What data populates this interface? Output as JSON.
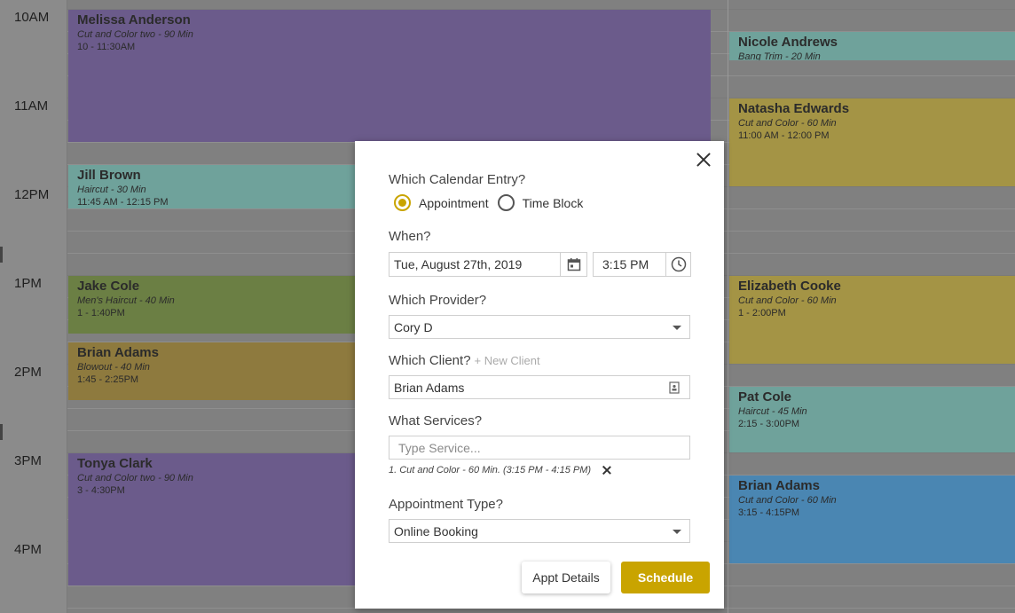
{
  "calendar": {
    "time_labels": [
      "10AM",
      "11AM",
      "12PM",
      "1PM",
      "2PM",
      "3PM",
      "4PM"
    ],
    "left_column": [
      {
        "name": "Melissa Anderson",
        "service": "Cut and Color two - 90 Min",
        "time": "10 - 11:30AM",
        "color": "#6b5b8b"
      },
      {
        "name": "Jill Brown",
        "service": "Haircut - 30 Min",
        "time": "11:45 AM - 12:15 PM",
        "color": "#6fa29b"
      },
      {
        "name": "Jake Cole",
        "service": "Men's Haircut - 40 Min",
        "time": "1 - 1:40PM",
        "color": "#6b7f44"
      },
      {
        "name": "Brian Adams",
        "service": "Blowout - 40 Min",
        "time": "1:45 - 2:25PM",
        "color": "#8e7a3e"
      },
      {
        "name": "Tonya Clark",
        "service": "Cut and Color two - 90 Min",
        "time": "3 - 4:30PM",
        "color": "#6b5b8b"
      }
    ],
    "right_column": [
      {
        "name": "Nicole Andrews",
        "service": "Bang Trim - 20 Min",
        "time": "",
        "color": "#6fa29b"
      },
      {
        "name": "Natasha Edwards",
        "service": "Cut and Color - 60 Min",
        "time": "11:00 AM - 12:00 PM",
        "color": "#a49445"
      },
      {
        "name": "Elizabeth Cooke",
        "service": "Cut and Color - 60 Min",
        "time": "1 - 2:00PM",
        "color": "#a49445"
      },
      {
        "name": "Pat Cole",
        "service": "Haircut - 45 Min",
        "time": "2:15 - 3:00PM",
        "color": "#6fa29b"
      },
      {
        "name": "Brian Adams",
        "service": "Cut and Color - 60 Min",
        "time": "3:15 - 4:15PM",
        "color": "#4a86b2"
      }
    ]
  },
  "modal": {
    "q_entry": "Which Calendar Entry?",
    "radio_appointment": "Appointment",
    "radio_timeblock": "Time Block",
    "selected_entry": "Appointment",
    "q_when": "When?",
    "date_value": "Tue, August 27th, 2019",
    "time_value": "3:15 PM",
    "q_provider": "Which Provider?",
    "provider_value": "Cory D",
    "q_client": "Which Client?",
    "new_client_link": "+ New Client",
    "client_value": "Brian Adams",
    "q_services": "What Services?",
    "service_placeholder": "Type Service...",
    "selected_service": "1. Cut and Color - 60 Min. (3:15 PM - 4:15 PM)",
    "q_type": "Appointment Type?",
    "type_value": "Online Booking",
    "appt_details_label": "Appt Details",
    "schedule_label": "Schedule",
    "accent_color": "#c9a400"
  }
}
